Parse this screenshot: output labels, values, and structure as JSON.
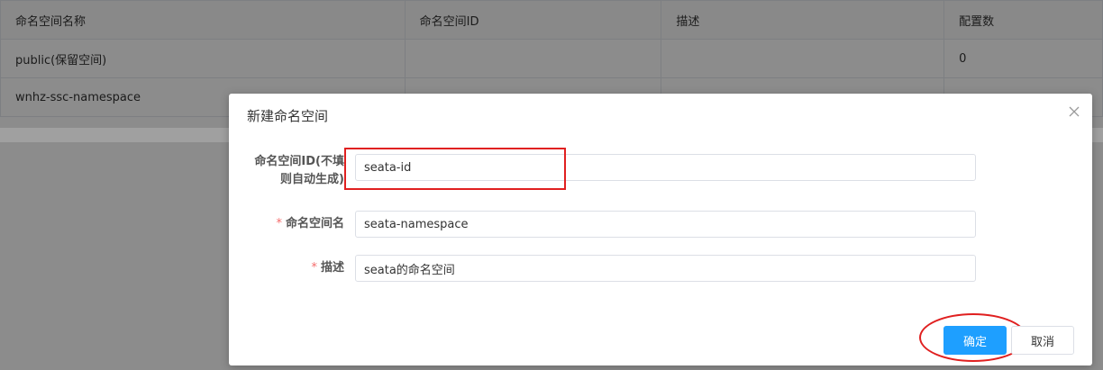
{
  "table": {
    "headers": [
      "命名空间名称",
      "命名空间ID",
      "描述",
      "配置数"
    ],
    "rows": [
      [
        "public(保留空间)",
        "",
        "",
        "0"
      ],
      [
        "wnhz-ssc-namespace",
        "",
        "",
        ""
      ]
    ]
  },
  "dialog": {
    "title": "新建命名空间",
    "fields": {
      "namespace_id": {
        "label_line1": "命名空间ID(不填",
        "label_line2": "则自动生成)",
        "value": "seata-id"
      },
      "namespace_name": {
        "required_mark": "*",
        "label": "命名空间名",
        "value": "seata-namespace"
      },
      "description": {
        "required_mark": "*",
        "label": "描述",
        "value": "seata的命名空间"
      }
    },
    "buttons": {
      "confirm": "确定",
      "cancel": "取消"
    }
  },
  "colors": {
    "primary": "#1e9fff",
    "required": "#f56c6c",
    "annotation": "#e02020"
  },
  "icons": {
    "close": "close-icon"
  }
}
